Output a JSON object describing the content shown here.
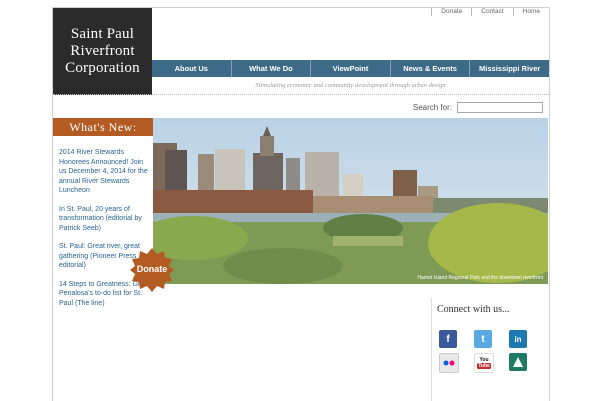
{
  "logo": {
    "line1": "Saint Paul",
    "line2": "Riverfront",
    "line3": "Corporation"
  },
  "utility_nav": [
    {
      "label": "Donate"
    },
    {
      "label": "Contact"
    },
    {
      "label": "Home"
    }
  ],
  "main_nav": [
    {
      "label": "About Us"
    },
    {
      "label": "What We Do"
    },
    {
      "label": "ViewPoint"
    },
    {
      "label": "News & Events"
    },
    {
      "label": "Mississippi River"
    }
  ],
  "tagline": "Stimulating economic and community development through urban design",
  "search": {
    "label": "Search for:",
    "value": ""
  },
  "news": {
    "heading": "What's New:",
    "items": [
      {
        "text": "2014 River Stewards Honorees Announced! Join us December 4, 2014 for the annual River Stewards Luncheon"
      },
      {
        "text": "In St. Paul, 20 years of transformation (editorial by Patrick Seeb)"
      },
      {
        "text": "St. Paul: Great river, great gathering (Pioneer Press editorial)"
      },
      {
        "text": "14 Steps to Greatness: Gil Penalosa's to-do list for St. Paul (The line)"
      }
    ]
  },
  "hero": {
    "caption": "Harriet Island Regional Park and the downtown riverfront"
  },
  "donate": {
    "label": "Donate",
    "color": "#b35b23"
  },
  "connect": {
    "heading": "Connect with us...",
    "icons": [
      "facebook-icon",
      "twitter-icon",
      "linkedin-icon",
      "flickr-icon",
      "youtube-icon",
      "other-social-icon"
    ]
  },
  "colors": {
    "nav": "#3d6a86",
    "accent": "#b35b23",
    "logo_bg": "#2b2b2b",
    "link": "#2a6495"
  }
}
